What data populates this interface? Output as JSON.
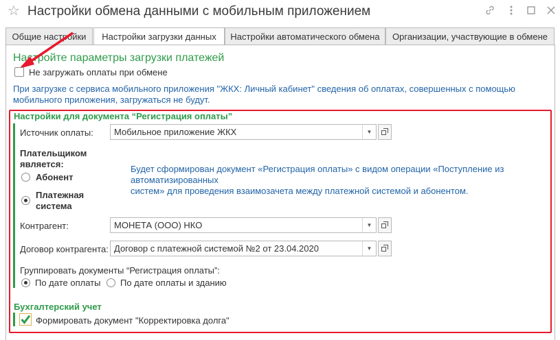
{
  "window": {
    "title": "Настройки обмена данными с мобильным приложением",
    "star_icon": "star-icon",
    "link_icon": "link-icon",
    "more_icon": "more-vertical-icon",
    "maximize_icon": "maximize-icon",
    "close_icon": "close-icon"
  },
  "tabs": [
    {
      "label": "Общие настройки",
      "active": false
    },
    {
      "label": "Настройки загрузки данных",
      "active": true
    },
    {
      "label": "Настройки автоматического обмена",
      "active": false
    },
    {
      "label": "Организации, участвующие в обмене",
      "active": false
    }
  ],
  "main": {
    "heading": "Настройте параметры загрузки платежей",
    "no_load_checkbox": {
      "label": "Не загружать оплаты при обмене",
      "checked": false
    },
    "info_line1": "При загрузке с сервиса мобильного приложения \"ЖКХ: Личный кабинет\" сведения об оплатах, совершенных с помощью",
    "info_line2": "мобильного приложения, загружаться не будут."
  },
  "doc_settings": {
    "heading": "Настройки для документа “Регистрация оплаты”",
    "source_label": "Источник оплаты:",
    "source_value": "Мобильное приложение ЖКХ",
    "payer_label_line1": "Плательщиком",
    "payer_label_line2": "является:",
    "payer_options": [
      {
        "label": "Абонент",
        "selected": false
      },
      {
        "label_line1": "Платежная",
        "label_line2": "система",
        "selected": true
      }
    ],
    "payer_info_line1": "Будет сформирован документ «Регистрация оплаты» с видом операции «Поступление из",
    "payer_info_line2": "автоматизированных",
    "payer_info_line3": "систем» для проведения взаимозачета между платежной системой и абонентом.",
    "counterparty_label": "Контрагент:",
    "counterparty_value": "МОНЕТА (ООО) НКО",
    "contract_label": "Договор контрагента:",
    "contract_value": "Договор с платежной системой №2 от 23.04.2020",
    "group_label": "Группировать документы “Регистрация оплаты”:",
    "group_options": [
      {
        "label": "По дате оплаты",
        "selected": true
      },
      {
        "label": "По дате оплаты и зданию",
        "selected": false
      }
    ]
  },
  "accounting": {
    "heading": "Бухгалтерский учет",
    "debt_checkbox": {
      "label": "Формировать документ \"Корректировка долга\"",
      "checked": true
    }
  },
  "colors": {
    "accent_green": "#2e9b4a",
    "info_blue": "#2264a8",
    "highlight_red": "#e8192c"
  }
}
